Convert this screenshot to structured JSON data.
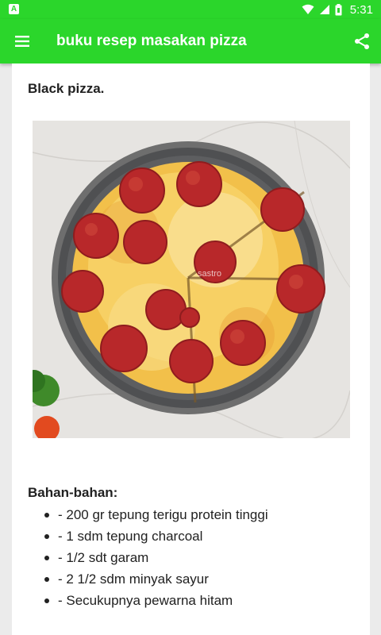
{
  "status_bar": {
    "app_icon_letter": "A",
    "time": "5:31"
  },
  "app_bar": {
    "title": "buku resep masakan pizza",
    "menu_icon": "hamburger-menu-icon",
    "share_icon": "share-icon",
    "color": "#2bd62b"
  },
  "recipe": {
    "title": "Black pizza.",
    "image": {
      "subject": "pepperoni-pizza-photo",
      "watermark": "sastro"
    },
    "ingredients_heading": "Bahan-bahan:",
    "ingredients": [
      "- 200 gr tepung terigu protein tinggi",
      "- 1 sdm tepung charcoal",
      "- 1/2 sdt garam",
      "- 2 1/2 sdm minyak sayur",
      "- Secukupnya pewarna hitam"
    ]
  }
}
